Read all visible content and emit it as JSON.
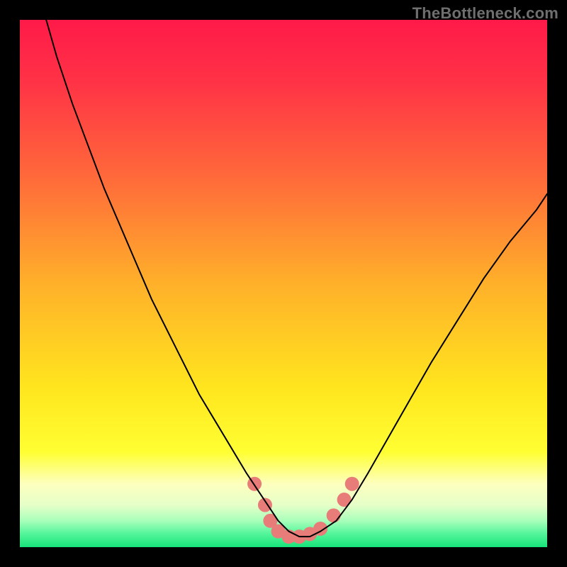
{
  "watermark": "TheBottleneck.com",
  "chart_data": {
    "type": "line",
    "title": "",
    "xlabel": "",
    "ylabel": "",
    "xlim": [
      0,
      100
    ],
    "ylim": [
      0,
      100
    ],
    "background": {
      "type": "vertical-gradient",
      "stops": [
        {
          "offset": 0.0,
          "color": "#ff1a49"
        },
        {
          "offset": 0.12,
          "color": "#ff3346"
        },
        {
          "offset": 0.3,
          "color": "#ff6a3a"
        },
        {
          "offset": 0.5,
          "color": "#ffb02a"
        },
        {
          "offset": 0.7,
          "color": "#ffe61e"
        },
        {
          "offset": 0.82,
          "color": "#ffff33"
        },
        {
          "offset": 0.88,
          "color": "#fdffbf"
        },
        {
          "offset": 0.92,
          "color": "#e6ffc8"
        },
        {
          "offset": 0.95,
          "color": "#a8ffba"
        },
        {
          "offset": 0.975,
          "color": "#52f59a"
        },
        {
          "offset": 1.0,
          "color": "#17e37a"
        }
      ]
    },
    "series": [
      {
        "name": "bottleneck-curve",
        "color": "#000000",
        "stroke_width": 2,
        "x": [
          5,
          7,
          10,
          13,
          16,
          19,
          22,
          25,
          28,
          31,
          34,
          37,
          40,
          43,
          45,
          47,
          49,
          51,
          53,
          55,
          57,
          60,
          63,
          66,
          70,
          74,
          78,
          83,
          88,
          93,
          98,
          100
        ],
        "y": [
          100,
          93,
          84,
          76,
          68,
          61,
          54,
          47,
          41,
          35,
          29,
          24,
          19,
          14,
          11,
          8,
          5,
          3,
          2,
          2,
          3,
          5,
          9,
          14,
          21,
          28,
          35,
          43,
          51,
          58,
          64,
          67
        ]
      }
    ],
    "markers": {
      "name": "bottom-cluster",
      "color": "#e77c78",
      "radius": 10,
      "points": [
        {
          "x": 44.5,
          "y": 12
        },
        {
          "x": 46.5,
          "y": 8
        },
        {
          "x": 47.5,
          "y": 5
        },
        {
          "x": 49.0,
          "y": 3
        },
        {
          "x": 51.0,
          "y": 2
        },
        {
          "x": 53.0,
          "y": 2
        },
        {
          "x": 55.0,
          "y": 2.5
        },
        {
          "x": 57.0,
          "y": 3.5
        },
        {
          "x": 59.5,
          "y": 6
        },
        {
          "x": 61.5,
          "y": 9
        },
        {
          "x": 63.0,
          "y": 12
        }
      ]
    }
  }
}
